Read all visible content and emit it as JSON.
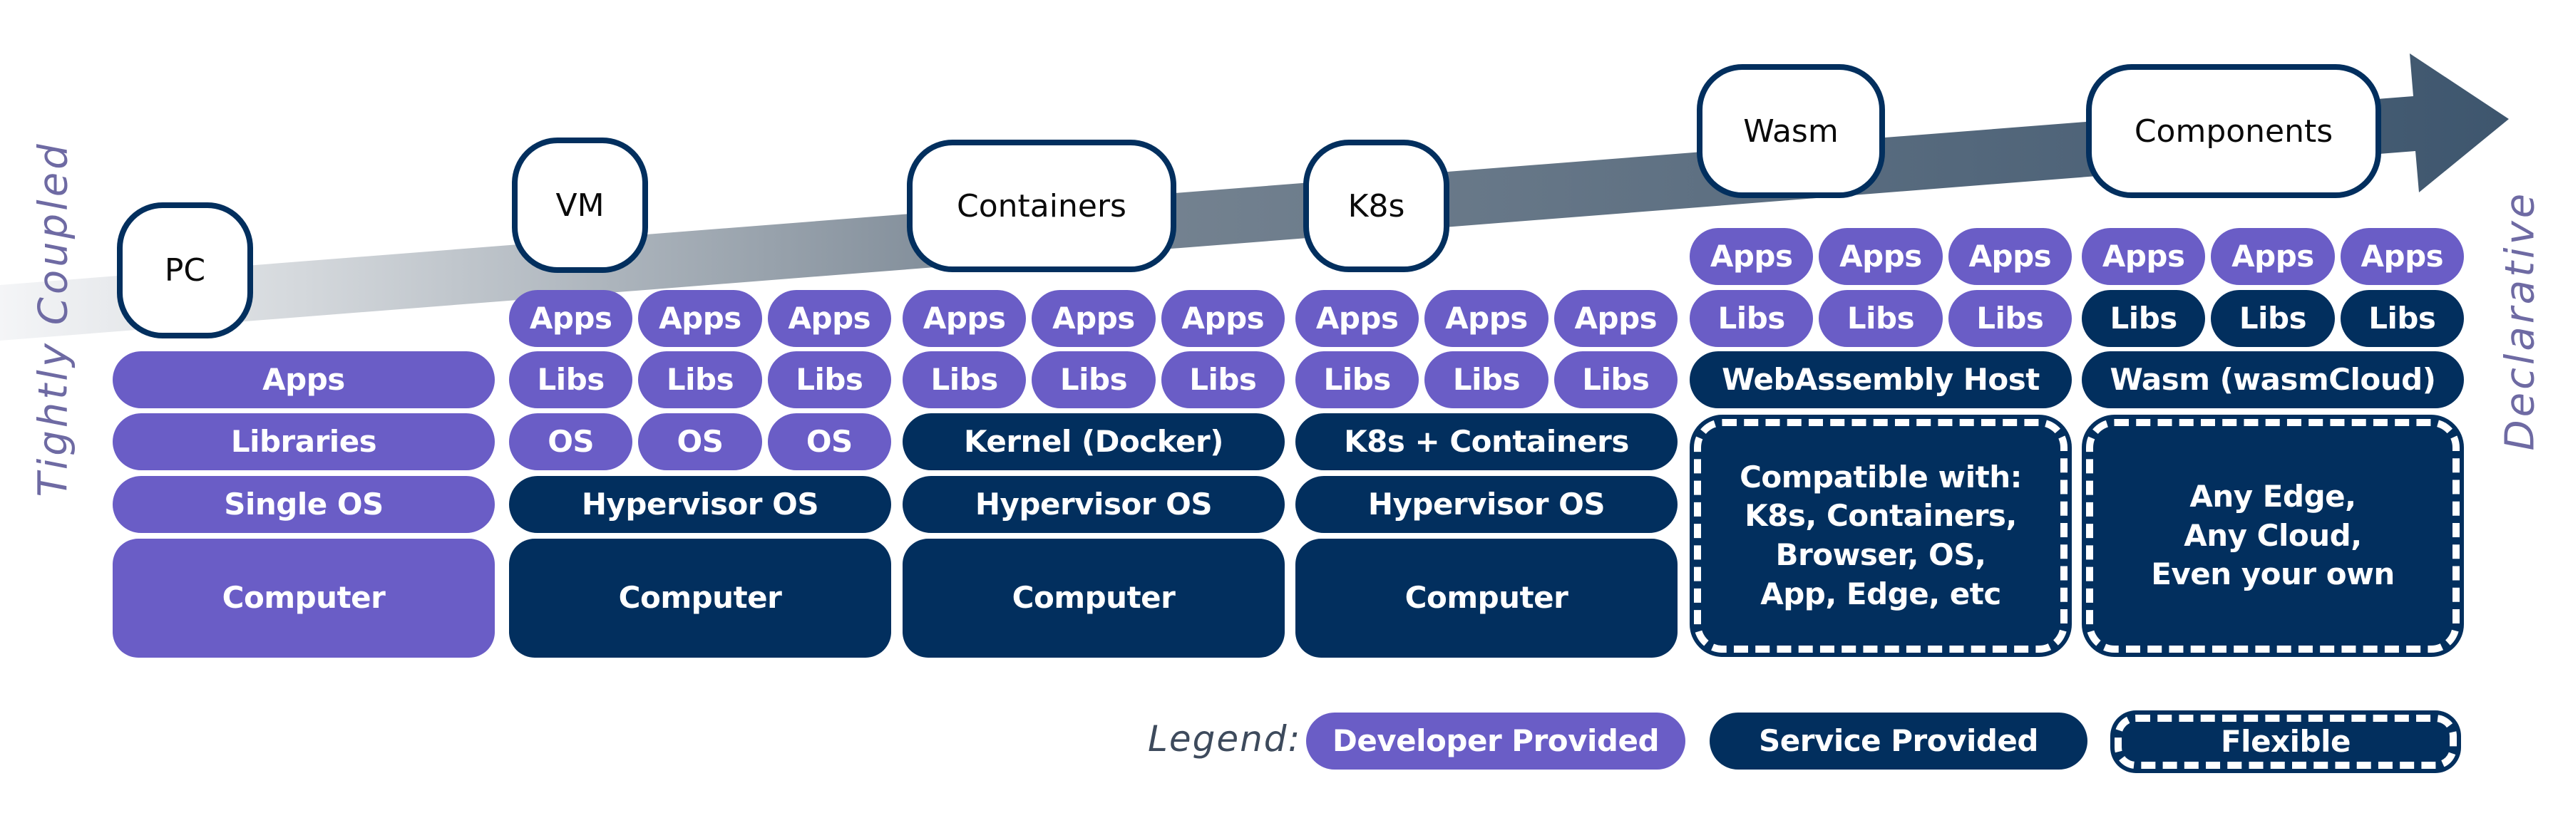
{
  "colors": {
    "developer": "#6a5dc6",
    "service": "#022f5e",
    "arrow_start": "#f4f5f7",
    "arrow_end": "#3e566e",
    "side_label": "#6e6aa3",
    "legend_label": "#3d4a5c"
  },
  "axis": {
    "left_label": "Tightly Coupled",
    "right_label": "Declarative",
    "arrow_icon": "arrow-right-icon"
  },
  "stages": [
    {
      "id": "pc",
      "label": "PC"
    },
    {
      "id": "vm",
      "label": "VM"
    },
    {
      "id": "containers",
      "label": "Containers"
    },
    {
      "id": "k8s",
      "label": "K8s"
    },
    {
      "id": "wasm",
      "label": "Wasm"
    },
    {
      "id": "components",
      "label": "Components"
    }
  ],
  "columns": {
    "pc": {
      "rows": [
        {
          "cells": [
            {
              "text": "Apps",
              "kind": "developer"
            }
          ]
        },
        {
          "cells": [
            {
              "text": "Libraries",
              "kind": "developer"
            }
          ]
        },
        {
          "cells": [
            {
              "text": "Single OS",
              "kind": "developer"
            }
          ]
        },
        {
          "cells": [
            {
              "text": "Computer",
              "kind": "developer"
            }
          ]
        }
      ]
    },
    "vm": {
      "rows": [
        {
          "cells": [
            {
              "text": "Apps",
              "kind": "developer"
            },
            {
              "text": "Apps",
              "kind": "developer"
            },
            {
              "text": "Apps",
              "kind": "developer"
            }
          ]
        },
        {
          "cells": [
            {
              "text": "Libs",
              "kind": "developer"
            },
            {
              "text": "Libs",
              "kind": "developer"
            },
            {
              "text": "Libs",
              "kind": "developer"
            }
          ]
        },
        {
          "cells": [
            {
              "text": "OS",
              "kind": "developer"
            },
            {
              "text": "OS",
              "kind": "developer"
            },
            {
              "text": "OS",
              "kind": "developer"
            }
          ]
        },
        {
          "cells": [
            {
              "text": "Hypervisor OS",
              "kind": "service"
            }
          ]
        },
        {
          "cells": [
            {
              "text": "Computer",
              "kind": "service"
            }
          ]
        }
      ]
    },
    "containers": {
      "rows": [
        {
          "cells": [
            {
              "text": "Apps",
              "kind": "developer"
            },
            {
              "text": "Apps",
              "kind": "developer"
            },
            {
              "text": "Apps",
              "kind": "developer"
            }
          ]
        },
        {
          "cells": [
            {
              "text": "Libs",
              "kind": "developer"
            },
            {
              "text": "Libs",
              "kind": "developer"
            },
            {
              "text": "Libs",
              "kind": "developer"
            }
          ]
        },
        {
          "cells": [
            {
              "text": "Kernel (Docker)",
              "kind": "service"
            }
          ]
        },
        {
          "cells": [
            {
              "text": "Hypervisor OS",
              "kind": "service"
            }
          ]
        },
        {
          "cells": [
            {
              "text": "Computer",
              "kind": "service"
            }
          ]
        }
      ]
    },
    "k8s": {
      "rows": [
        {
          "cells": [
            {
              "text": "Apps",
              "kind": "developer"
            },
            {
              "text": "Apps",
              "kind": "developer"
            },
            {
              "text": "Apps",
              "kind": "developer"
            }
          ]
        },
        {
          "cells": [
            {
              "text": "Libs",
              "kind": "developer"
            },
            {
              "text": "Libs",
              "kind": "developer"
            },
            {
              "text": "Libs",
              "kind": "developer"
            }
          ]
        },
        {
          "cells": [
            {
              "text": "K8s + Containers",
              "kind": "service"
            }
          ]
        },
        {
          "cells": [
            {
              "text": "Hypervisor OS",
              "kind": "service"
            }
          ]
        },
        {
          "cells": [
            {
              "text": "Computer",
              "kind": "service"
            }
          ]
        }
      ]
    },
    "wasm": {
      "rows": [
        {
          "cells": [
            {
              "text": "Apps",
              "kind": "developer"
            },
            {
              "text": "Apps",
              "kind": "developer"
            },
            {
              "text": "Apps",
              "kind": "developer"
            }
          ]
        },
        {
          "cells": [
            {
              "text": "Libs",
              "kind": "developer"
            },
            {
              "text": "Libs",
              "kind": "developer"
            },
            {
              "text": "Libs",
              "kind": "developer"
            }
          ]
        },
        {
          "cells": [
            {
              "text": "WebAssembly Host",
              "kind": "service"
            }
          ]
        },
        {
          "cells": [
            {
              "text": "Compatible with:\nK8s, Containers,\nBrowser, OS,\nApp, Edge, etc",
              "kind": "flexible"
            }
          ]
        }
      ]
    },
    "components": {
      "rows": [
        {
          "cells": [
            {
              "text": "Apps",
              "kind": "developer"
            },
            {
              "text": "Apps",
              "kind": "developer"
            },
            {
              "text": "Apps",
              "kind": "developer"
            }
          ]
        },
        {
          "cells": [
            {
              "text": "Libs",
              "kind": "service"
            },
            {
              "text": "Libs",
              "kind": "service"
            },
            {
              "text": "Libs",
              "kind": "service"
            }
          ]
        },
        {
          "cells": [
            {
              "text": "Wasm (wasmCloud)",
              "kind": "service"
            }
          ]
        },
        {
          "cells": [
            {
              "text": "Any Edge,\nAny Cloud,\nEven your own",
              "kind": "flexible"
            }
          ]
        }
      ]
    }
  },
  "legend": {
    "label": "Legend:",
    "items": [
      {
        "text": "Developer Provided",
        "kind": "developer"
      },
      {
        "text": "Service Provided",
        "kind": "service"
      },
      {
        "text": "Flexible",
        "kind": "flexible"
      }
    ]
  }
}
